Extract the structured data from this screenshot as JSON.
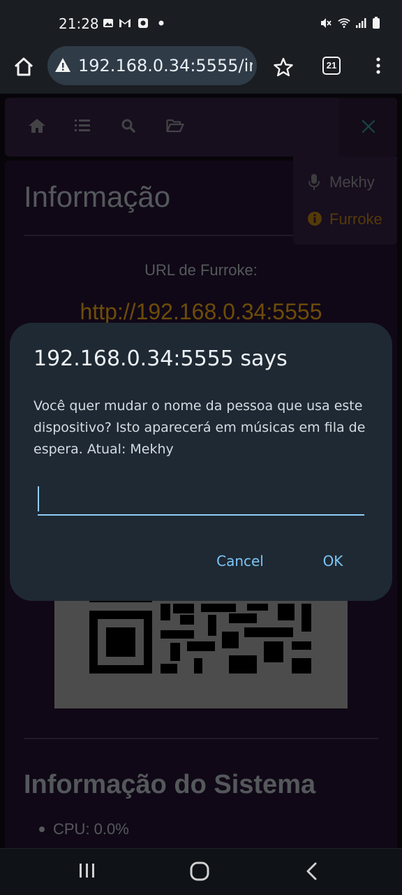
{
  "status_bar": {
    "time": "21:28",
    "icons": [
      "gallery-icon",
      "gmail-icon",
      "app-icon",
      "dot-icon",
      "mute-icon",
      "wifi-icon",
      "signal-icon",
      "battery-icon"
    ]
  },
  "browser": {
    "url": "192.168.0.34:5555/info",
    "tab_count": "21",
    "icons": [
      "home-icon",
      "warning-icon",
      "star-icon",
      "tabs-icon",
      "more-icon"
    ]
  },
  "site_nav": {
    "icons": [
      "home-icon",
      "queue-list-icon",
      "search-icon",
      "folder-icon",
      "close-icon"
    ],
    "dropdown": [
      {
        "icon": "microphone-icon",
        "label": "Mekhy"
      },
      {
        "icon": "info-icon",
        "label": "Furroke"
      }
    ]
  },
  "page": {
    "heading": "Informação",
    "url_label": "URL de Furroke:",
    "url_link": "http://192.168.0.34:5555",
    "system_heading": "Informação do Sistema",
    "system_items": [
      "CPU: 0.0%"
    ]
  },
  "dialog": {
    "title": "192.168.0.34:5555 says",
    "message": "Você quer mudar o nome da pessoa que usa este dispositivo? Isto aparecerá em músicas em fila de espera. Atual: Mekhy",
    "input_value": "",
    "cancel": "Cancel",
    "ok": "OK"
  },
  "colors": {
    "accent_link": "#c98a12",
    "dialog_button": "#7cc6f8",
    "nav_bg": "#2a1a38",
    "card_bg": "#1e0f29"
  },
  "android_nav": {
    "icons": [
      "recents-icon",
      "home-button-icon",
      "back-icon"
    ]
  }
}
